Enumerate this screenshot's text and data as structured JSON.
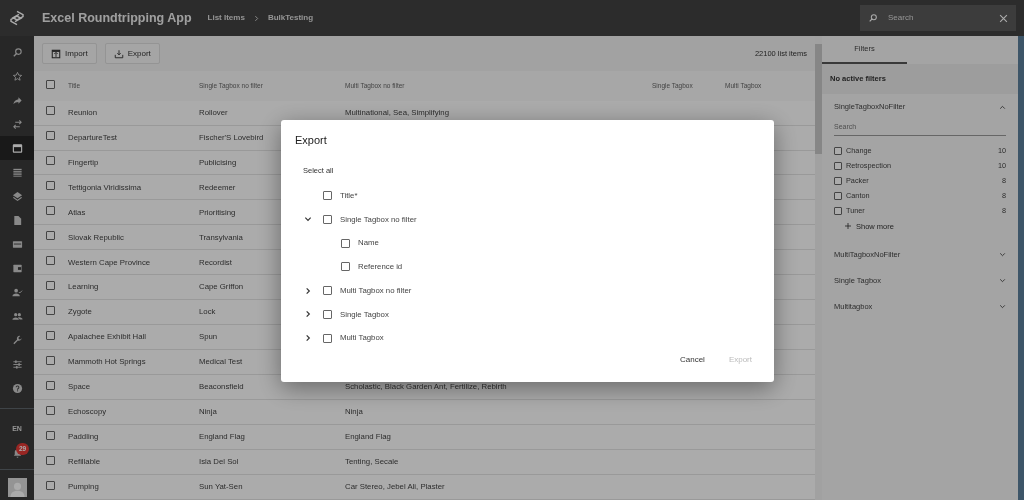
{
  "app": {
    "title": "Excel Roundtripping App",
    "breadcrumb": [
      "List Items",
      "BulkTesting"
    ],
    "search": {
      "placeholder": "Search"
    }
  },
  "sidebar": {
    "items": [
      {
        "kind": "search",
        "selected": false
      },
      {
        "kind": "star",
        "selected": false
      },
      {
        "kind": "share",
        "selected": false
      },
      {
        "kind": "swap",
        "selected": false
      },
      {
        "kind": "window",
        "selected": true
      },
      {
        "kind": "list",
        "selected": false
      },
      {
        "kind": "layers",
        "selected": false
      },
      {
        "kind": "document",
        "selected": false
      },
      {
        "kind": "card",
        "selected": false
      },
      {
        "kind": "wallet",
        "selected": false
      },
      {
        "kind": "person-check",
        "selected": false
      },
      {
        "kind": "people",
        "selected": false
      },
      {
        "kind": "wrench",
        "selected": false
      },
      {
        "kind": "sliders",
        "selected": false
      },
      {
        "kind": "help",
        "selected": false
      }
    ],
    "language": "EN",
    "notifications": "29"
  },
  "toolbar": {
    "buttons": [
      {
        "kind": "import",
        "label": "Import"
      },
      {
        "kind": "export",
        "label": "Export"
      }
    ],
    "count": "22100 list items"
  },
  "table": {
    "select_all_checked": false,
    "columns": [
      "Title",
      "Single Tagbox no filter",
      "Multi Tagbox no filter",
      "Single Tagbox",
      "Multi Tagbox"
    ],
    "rows": [
      {
        "checked": false,
        "cells": [
          "Reunion",
          "Rollover",
          "Multinational, Sea, Simplifying"
        ]
      },
      {
        "checked": false,
        "cells": [
          "DepartureTest",
          "Fischer'S Lovebird"
        ]
      },
      {
        "checked": false,
        "cells": [
          "Fingertip",
          "Publicising"
        ]
      },
      {
        "checked": false,
        "cells": [
          "Tettigonia Viridissima",
          "Redeemer"
        ]
      },
      {
        "checked": false,
        "cells": [
          "Atlas",
          "Prioritising"
        ]
      },
      {
        "checked": false,
        "cells": [
          "Slovak Republic",
          "Transylvania"
        ]
      },
      {
        "checked": false,
        "cells": [
          "Western Cape Province",
          "Recordist"
        ]
      },
      {
        "checked": false,
        "cells": [
          "Learning",
          "Cape Griffon"
        ]
      },
      {
        "checked": false,
        "cells": [
          "Zygote",
          "Lock"
        ]
      },
      {
        "checked": false,
        "cells": [
          "Apalachee Exhibit Hall",
          "Spun"
        ]
      },
      {
        "checked": false,
        "cells": [
          "Mammoth Hot Springs",
          "Medical Test"
        ]
      },
      {
        "checked": false,
        "cells": [
          "Space",
          "Beaconsfield",
          "Scholastic, Black Garden Ant, Fertilize, Rebirth"
        ]
      },
      {
        "checked": false,
        "cells": [
          "Echoscopy",
          "Ninja",
          "Ninja"
        ]
      },
      {
        "checked": false,
        "cells": [
          "Paddling",
          "England Flag",
          "England Flag"
        ]
      },
      {
        "checked": false,
        "cells": [
          "Refillable",
          "Isla Del Sol",
          "Tenting, Secale"
        ]
      },
      {
        "checked": false,
        "cells": [
          "Pumping",
          "Sun Yat-Sen",
          "Car Stereo, Jebel Ali, Plaster"
        ]
      }
    ]
  },
  "filters": {
    "tabs": [
      {
        "label": "Filters",
        "selected": true
      }
    ],
    "status": "No active filters",
    "sections": [
      {
        "title": "SingleTagboxNoFilter",
        "expanded": true,
        "search": {
          "placeholder": "Search"
        },
        "options": [
          {
            "label": "Change",
            "count": "10",
            "checked": false
          },
          {
            "label": "Retrospection",
            "count": "10",
            "checked": false
          },
          {
            "label": "Packer",
            "count": "8",
            "checked": false
          },
          {
            "label": "Canton",
            "count": "8",
            "checked": false
          },
          {
            "label": "Tuner",
            "count": "8",
            "checked": false
          }
        ],
        "show_more": "Show more"
      },
      {
        "title": "MultiTagboxNoFilter",
        "expanded": false
      },
      {
        "title": "Single Tagbox",
        "expanded": false
      },
      {
        "title": "Multitagbox",
        "expanded": false
      }
    ]
  },
  "dialog": {
    "title": "Export",
    "select_all": "Select all",
    "tree": [
      {
        "kind": "leaf",
        "label": "Title*",
        "checked": false
      },
      {
        "kind": "group",
        "label": "Single Tagbox no filter",
        "checked": false,
        "expanded": true,
        "children": [
          {
            "kind": "leaf",
            "label": "Name",
            "checked": false
          },
          {
            "kind": "leaf",
            "label": "Reference id",
            "checked": false
          }
        ]
      },
      {
        "kind": "group",
        "label": "Multi Tagbox no filter",
        "checked": false,
        "expanded": false
      },
      {
        "kind": "group",
        "label": "Single Tagbox",
        "checked": false,
        "expanded": false
      },
      {
        "kind": "group",
        "label": "Multi Tagbox",
        "checked": false,
        "expanded": false
      }
    ],
    "buttons": [
      {
        "label": "Cancel",
        "disabled": false
      },
      {
        "label": "Export",
        "disabled": true
      }
    ]
  }
}
